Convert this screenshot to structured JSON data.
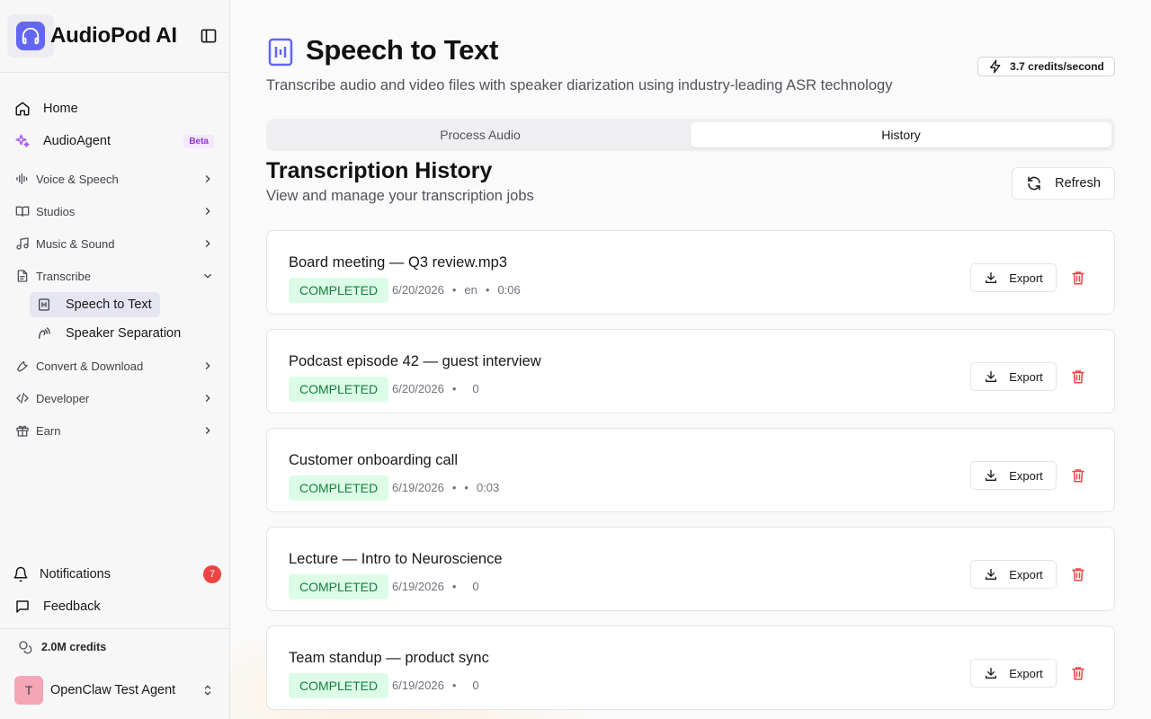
{
  "brand": {
    "name": "AudioPod AI"
  },
  "sidebar": {
    "items": [
      {
        "label": "Home",
        "icon": "home-icon"
      },
      {
        "label": "AudioAgent",
        "icon": "sparkle-icon",
        "badge": "Beta"
      },
      {
        "label": "Voice & Speech",
        "icon": "waveform-icon"
      },
      {
        "label": "Studios",
        "icon": "book-icon"
      },
      {
        "label": "Music & Sound",
        "icon": "music-icon"
      },
      {
        "label": "Transcribe",
        "icon": "document-icon",
        "expanded": true
      },
      {
        "label": "Convert & Download",
        "icon": "wrench-icon"
      },
      {
        "label": "Developer",
        "icon": "code-icon"
      },
      {
        "label": "Earn",
        "icon": "gift-icon"
      }
    ],
    "transcribe_sub": [
      {
        "label": "Speech to Text",
        "active": true
      },
      {
        "label": "Speaker Separation"
      }
    ],
    "notifications": {
      "label": "Notifications",
      "count": "7"
    },
    "feedback": {
      "label": "Feedback"
    },
    "credits": "2.0M credits",
    "user": {
      "initial": "T",
      "name": "OpenClaw Test Agent"
    }
  },
  "header": {
    "title": "Speech to Text",
    "subtitle": "Transcribe audio and video files with speaker diarization using industry-leading ASR technology",
    "rate": "3.7 credits/second"
  },
  "tabs": [
    {
      "label": "Process Audio"
    },
    {
      "label": "History",
      "active": true
    }
  ],
  "history": {
    "title": "Transcription History",
    "subtitle": "View and manage your transcription jobs",
    "refresh_label": "Refresh",
    "export_label": "Export",
    "jobs": [
      {
        "name": "Board meeting — Q3 review.mp3",
        "status": "COMPLETED",
        "date": "6/20/2026",
        "lang": "en",
        "duration": "0:06"
      },
      {
        "name": "Podcast episode 42 — guest interview",
        "status": "COMPLETED",
        "date": "6/20/2026",
        "lang": "",
        "duration": "0"
      },
      {
        "name": "Customer onboarding call",
        "status": "COMPLETED",
        "date": "6/19/2026",
        "lang": "",
        "duration": "0:03"
      },
      {
        "name": "Lecture — Intro to Neuroscience",
        "status": "COMPLETED",
        "date": "6/19/2026",
        "lang": "",
        "duration": "0"
      },
      {
        "name": "Team standup — product sync",
        "status": "COMPLETED",
        "date": "6/19/2026",
        "lang": "",
        "duration": "0"
      }
    ]
  },
  "colors": {
    "accent": "#6366f1",
    "status_bg": "#dcfce7",
    "status_text": "#15803d",
    "danger": "#ef4444"
  }
}
